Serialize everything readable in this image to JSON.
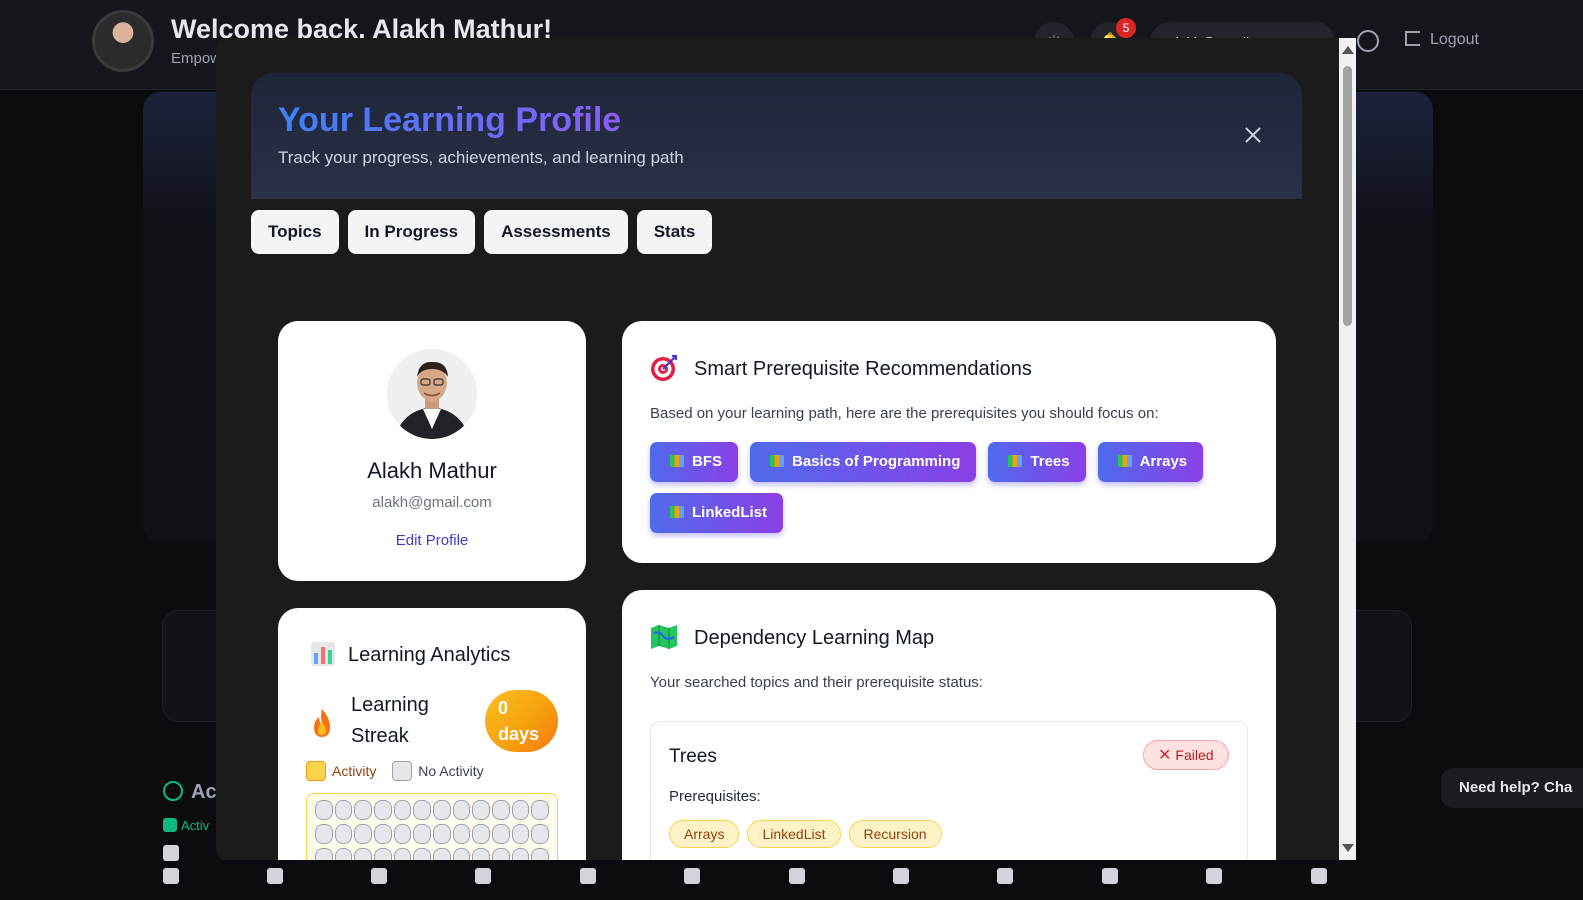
{
  "background": {
    "welcome": "Welcome back, Alakh Mathur!",
    "subtitle": "Empow",
    "notification_count": "5",
    "email_pill": "alakh@gmail...",
    "logout_label": "Logout",
    "section_title": "Ac",
    "legend_label": "Activ",
    "help_label": "Need help? Cha"
  },
  "modal": {
    "title": "Your Learning Profile",
    "subtitle": "Track your progress, achievements, and learning path",
    "tabs": [
      "Topics",
      "In Progress",
      "Assessments",
      "Stats"
    ]
  },
  "profile": {
    "name": "Alakh Mathur",
    "email": "alakh@gmail.com",
    "edit_label": "Edit Profile"
  },
  "analytics": {
    "title": "Learning Analytics",
    "streak_line1": "Learning",
    "streak_line2": "Streak",
    "streak_value": "0",
    "streak_unit": "days",
    "legend_activity": "Activity",
    "legend_no_activity": "No Activity"
  },
  "prerequisites": {
    "title": "Smart Prerequisite Recommendations",
    "description": "Based on your learning path, here are the prerequisites you should focus on:",
    "items": [
      "BFS",
      "Basics of Programming",
      "Trees",
      "Arrays",
      "LinkedList"
    ]
  },
  "dependency_map": {
    "title": "Dependency Learning Map",
    "description": "Your searched topics and their prerequisite status:",
    "topic": {
      "name": "Trees",
      "status": "Failed",
      "prereq_label": "Prerequisites:",
      "prerequisites": [
        "Arrays",
        "LinkedList",
        "Recursion"
      ]
    }
  },
  "colors": {
    "accent_start": "#3b82f6",
    "accent_end": "#8b5cf6",
    "streak": "#f59e0b",
    "failed": "#dc2626"
  }
}
